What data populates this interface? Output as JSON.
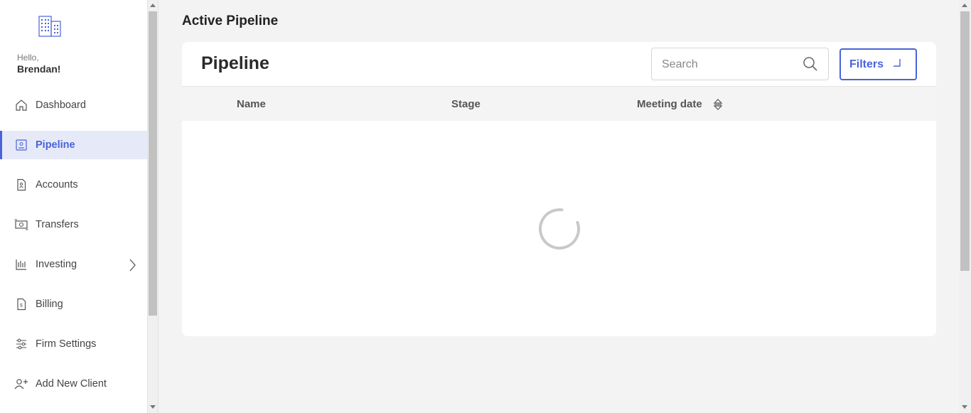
{
  "sidebar": {
    "greeting": "Hello,",
    "username": "Brendan!",
    "items": [
      {
        "label": "Dashboard",
        "icon": "home-icon"
      },
      {
        "label": "Pipeline",
        "icon": "contact-card-icon",
        "active": true
      },
      {
        "label": "Accounts",
        "icon": "document-icon"
      },
      {
        "label": "Transfers",
        "icon": "money-transfer-icon"
      },
      {
        "label": "Investing",
        "icon": "chart-icon",
        "expandable": true
      },
      {
        "label": "Billing",
        "icon": "invoice-icon"
      },
      {
        "label": "Firm Settings",
        "icon": "sliders-icon"
      },
      {
        "label": "Add New Client",
        "icon": "add-user-icon"
      }
    ]
  },
  "main": {
    "page_title": "Active Pipeline",
    "card_title": "Pipeline",
    "search_placeholder": "Search",
    "filters_label": "Filters",
    "columns": [
      "Name",
      "Stage",
      "Meeting date"
    ],
    "loading": true
  },
  "colors": {
    "accent": "#4a63d9",
    "active_bg": "#e6e9f8",
    "page_bg": "#f3f3f3"
  }
}
